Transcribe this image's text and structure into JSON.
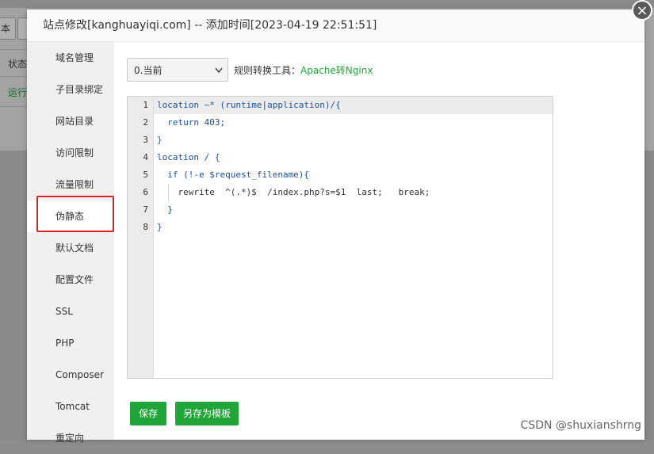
{
  "background": {
    "toolbar_buttons": [
      "本",
      ""
    ],
    "status_label": "状态",
    "status_value": "运行"
  },
  "dialog": {
    "title": "站点修改[kanghuayiqi.com] -- 添加时间[2023-04-19 22:51:51]",
    "close_glyph": "×"
  },
  "sidebar": {
    "items": [
      {
        "label": "域名管理"
      },
      {
        "label": "子目录绑定"
      },
      {
        "label": "网站目录"
      },
      {
        "label": "访问限制"
      },
      {
        "label": "流量限制"
      },
      {
        "label": "伪静态"
      },
      {
        "label": "默认文档"
      },
      {
        "label": "配置文件"
      },
      {
        "label": "SSL"
      },
      {
        "label": "PHP"
      },
      {
        "label": "Composer"
      },
      {
        "label": "Tomcat"
      },
      {
        "label": "重定向"
      }
    ],
    "active_index": 5
  },
  "rewrite": {
    "select_value": "0.当前",
    "tool_label": "规则转换工具：",
    "tool_link": "Apache转Nginx"
  },
  "editor": {
    "line_numbers": [
      "1",
      "2",
      "3",
      "4",
      "5",
      "6",
      "7",
      "8"
    ],
    "lines": [
      "location ~* (runtime|application)/{",
      "  return 403;",
      "}",
      "location / {",
      "  if (!-e $request_filename){",
      "    rewrite  ^(.*)$  /index.php?s=$1  last;   break;",
      "  }",
      "}"
    ]
  },
  "buttons": {
    "save": "保存",
    "save_as_template": "另存为模板"
  },
  "watermark": "CSDN @shuxianshrng",
  "colors": {
    "accent_green": "#20a53a",
    "highlight_red": "#e02020"
  }
}
